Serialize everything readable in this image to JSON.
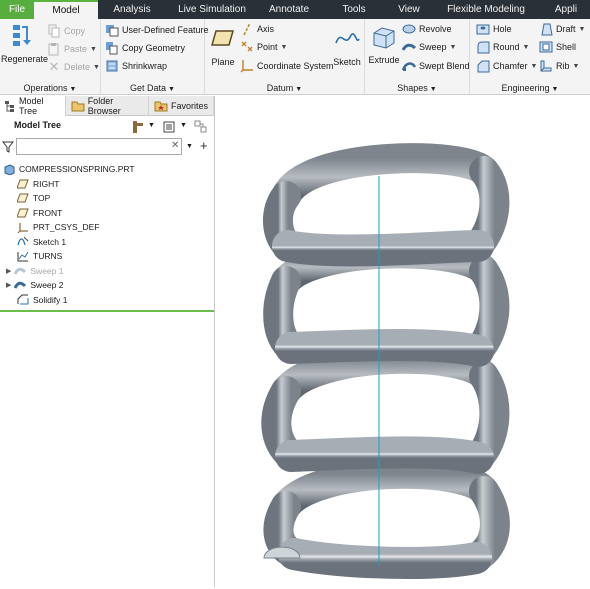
{
  "menu": {
    "tabs": [
      {
        "label": "File"
      },
      {
        "label": "Model"
      },
      {
        "label": "Analysis"
      },
      {
        "label": "Live Simulation"
      },
      {
        "label": "Annotate"
      },
      {
        "label": "Tools"
      },
      {
        "label": "View"
      },
      {
        "label": "Flexible Modeling"
      },
      {
        "label": "Appli"
      }
    ],
    "active": "Model"
  },
  "ribbon": {
    "operations": {
      "title": "Operations",
      "regenerate": "Regenerate",
      "copy": "Copy",
      "paste": "Paste",
      "delete": "Delete"
    },
    "getdata": {
      "title": "Get Data",
      "udf": "User-Defined Feature",
      "copygeom": "Copy Geometry",
      "shrinkwrap": "Shrinkwrap"
    },
    "datum": {
      "title": "Datum",
      "plane": "Plane",
      "axis": "Axis",
      "point": "Point",
      "csys": "Coordinate System",
      "sketch": "Sketch"
    },
    "shapes": {
      "title": "Shapes",
      "extrude": "Extrude",
      "revolve": "Revolve",
      "sweep": "Sweep",
      "sweptblend": "Swept Blend"
    },
    "engineering": {
      "title": "Engineering",
      "hole": "Hole",
      "round": "Round",
      "chamfer": "Chamfer",
      "draft": "Draft",
      "shell": "Shell",
      "rib": "Rib"
    }
  },
  "panel": {
    "tabs": {
      "modeltree": "Model Tree",
      "folder": "Folder Browser",
      "favorites": "Favorites"
    },
    "header": "Model Tree",
    "filter_value": "",
    "tree": {
      "root": "COMPRESSIONSPRING.PRT",
      "items": [
        "RIGHT",
        "TOP",
        "FRONT",
        "PRT_CSYS_DEF",
        "Sketch 1",
        "TURNS",
        "Sweep 1",
        "Sweep 2",
        "Solidify 1"
      ]
    }
  },
  "colors": {
    "menubar": "#2a3038",
    "file_tab": "#57ad3d",
    "accent_green": "#6cc04a",
    "spring": "#8c939c",
    "axis": "#1aa0c8"
  }
}
